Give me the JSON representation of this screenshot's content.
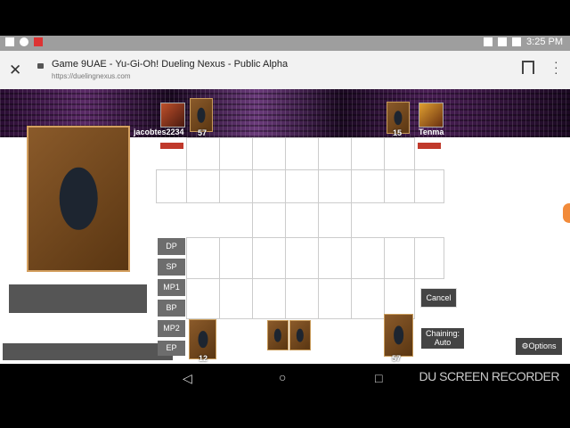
{
  "status": {
    "time": "3:25 PM"
  },
  "browser": {
    "title": "Game 9UAE - Yu-Gi-Oh! Dueling Nexus - Public Alpha",
    "url": "https://duelingnexus.com"
  },
  "players": {
    "left": {
      "name": "jacobtes2234",
      "deck_count": "57"
    },
    "right": {
      "name": "Tenma",
      "deck_count": "15"
    }
  },
  "phases": [
    "DP",
    "SP",
    "MP1",
    "BP",
    "MP2",
    "EP"
  ],
  "field": {
    "my_deck_count": "57",
    "my_extra_count": "12"
  },
  "buttons": {
    "cancel": "Cancel",
    "chaining_line1": "Chaining:",
    "chaining_line2": "Auto",
    "options": "Options"
  },
  "watermark": "DU SCREEN RECORDER"
}
